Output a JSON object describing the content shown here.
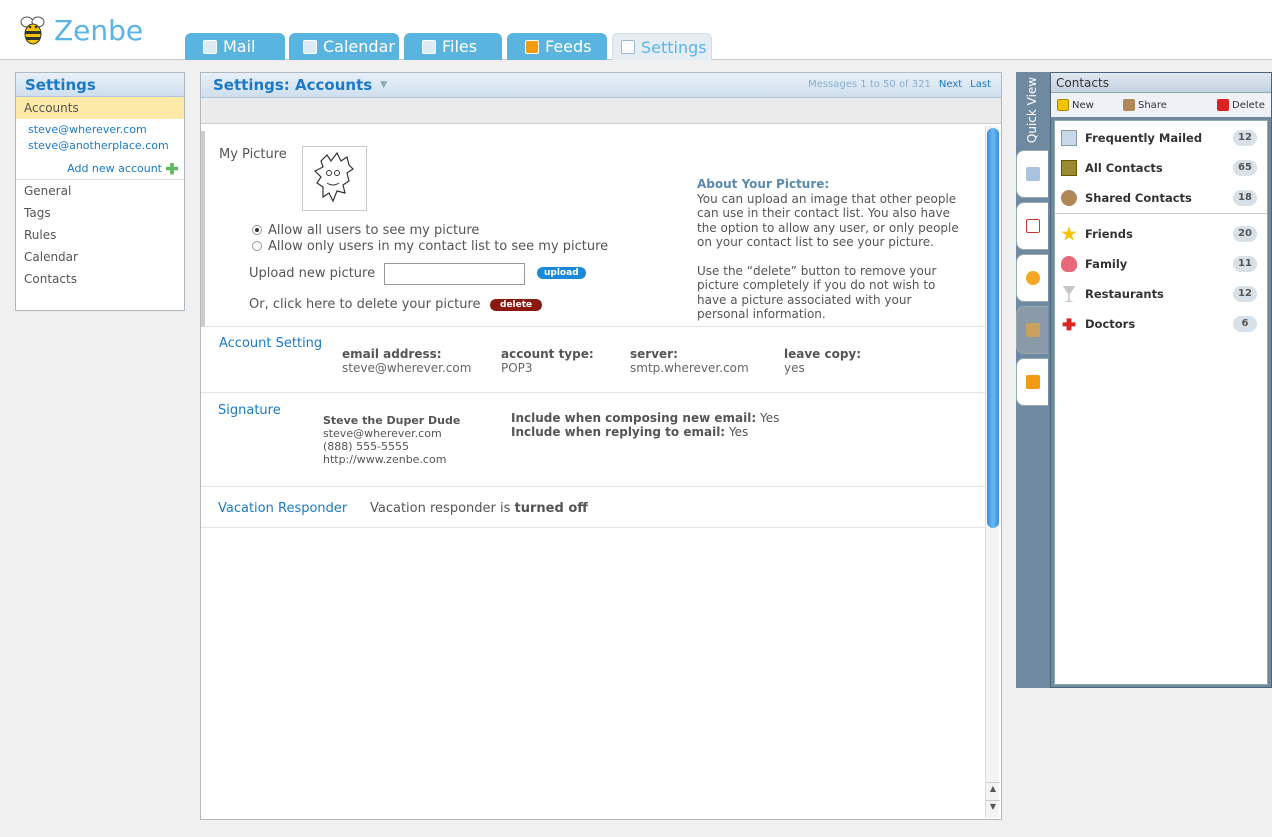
{
  "app": {
    "name": "Zenbe"
  },
  "tabs": [
    {
      "label": "Mail"
    },
    {
      "label": "Calendar"
    },
    {
      "label": "Files"
    },
    {
      "label": "Feeds"
    },
    {
      "label": "Settings"
    }
  ],
  "sidebar": {
    "title": "Settings",
    "selected": "Accounts",
    "accounts": [
      "steve@wherever.com",
      "steve@anotherplace.com"
    ],
    "add_account": "Add new account",
    "items": [
      "General",
      "Tags",
      "Rules",
      "Calendar",
      "Contacts"
    ]
  },
  "main": {
    "title": "Settings: Accounts",
    "pager": {
      "text": "Messages 1 to 50 of 321",
      "next": "Next",
      "last": "Last"
    },
    "picture": {
      "label": "My Picture",
      "radio_all": "Allow all users to see my picture",
      "radio_contacts": "Allow only users in my contact list to see my picture",
      "upload_label": "Upload new picture",
      "upload_button": "upload",
      "delete_label": "Or, click here to delete your picture",
      "delete_button": "delete",
      "about_title": "About Your Picture:",
      "about_p1": "You can upload an image that other people can use in their contact list. You also have the option to allow any user, or only people on your contact list to see your picture.",
      "about_p2": "Use the “delete” button to remove your picture completely if you do not wish to have a picture associated with your personal information."
    },
    "account_setting": {
      "label": "Account Setting",
      "fields": [
        {
          "name": "email address:",
          "value": "steve@wherever.com"
        },
        {
          "name": "account type:",
          "value": "POP3"
        },
        {
          "name": "server:",
          "value": "smtp.wherever.com"
        },
        {
          "name": "leave copy:",
          "value": "yes"
        }
      ]
    },
    "signature": {
      "label": "Signature",
      "name": "Steve the Duper Dude",
      "lines": [
        "steve@wherever.com",
        "(888) 555-5555",
        "http://www.zenbe.com"
      ],
      "compose_label": "Include when composing new email:",
      "compose_value": "Yes",
      "reply_label": "Include when replying to email:",
      "reply_value": "Yes"
    },
    "vacation": {
      "label": "Vacation Responder",
      "text": "Vacation responder is",
      "status": "turned off"
    }
  },
  "quickview": {
    "label": "Quick View"
  },
  "contacts": {
    "title": "Contacts",
    "toolbar": {
      "new": "New",
      "share": "Share",
      "delete": "Delete"
    },
    "groups": [
      {
        "name": "Frequently Mailed",
        "count": "12"
      },
      {
        "name": "All Contacts",
        "count": "65"
      },
      {
        "name": "Shared Contacts",
        "count": "18"
      },
      {
        "name": "Friends",
        "count": "20"
      },
      {
        "name": "Family",
        "count": "11"
      },
      {
        "name": "Restaurants",
        "count": "12"
      },
      {
        "name": "Doctors",
        "count": "6"
      }
    ]
  }
}
